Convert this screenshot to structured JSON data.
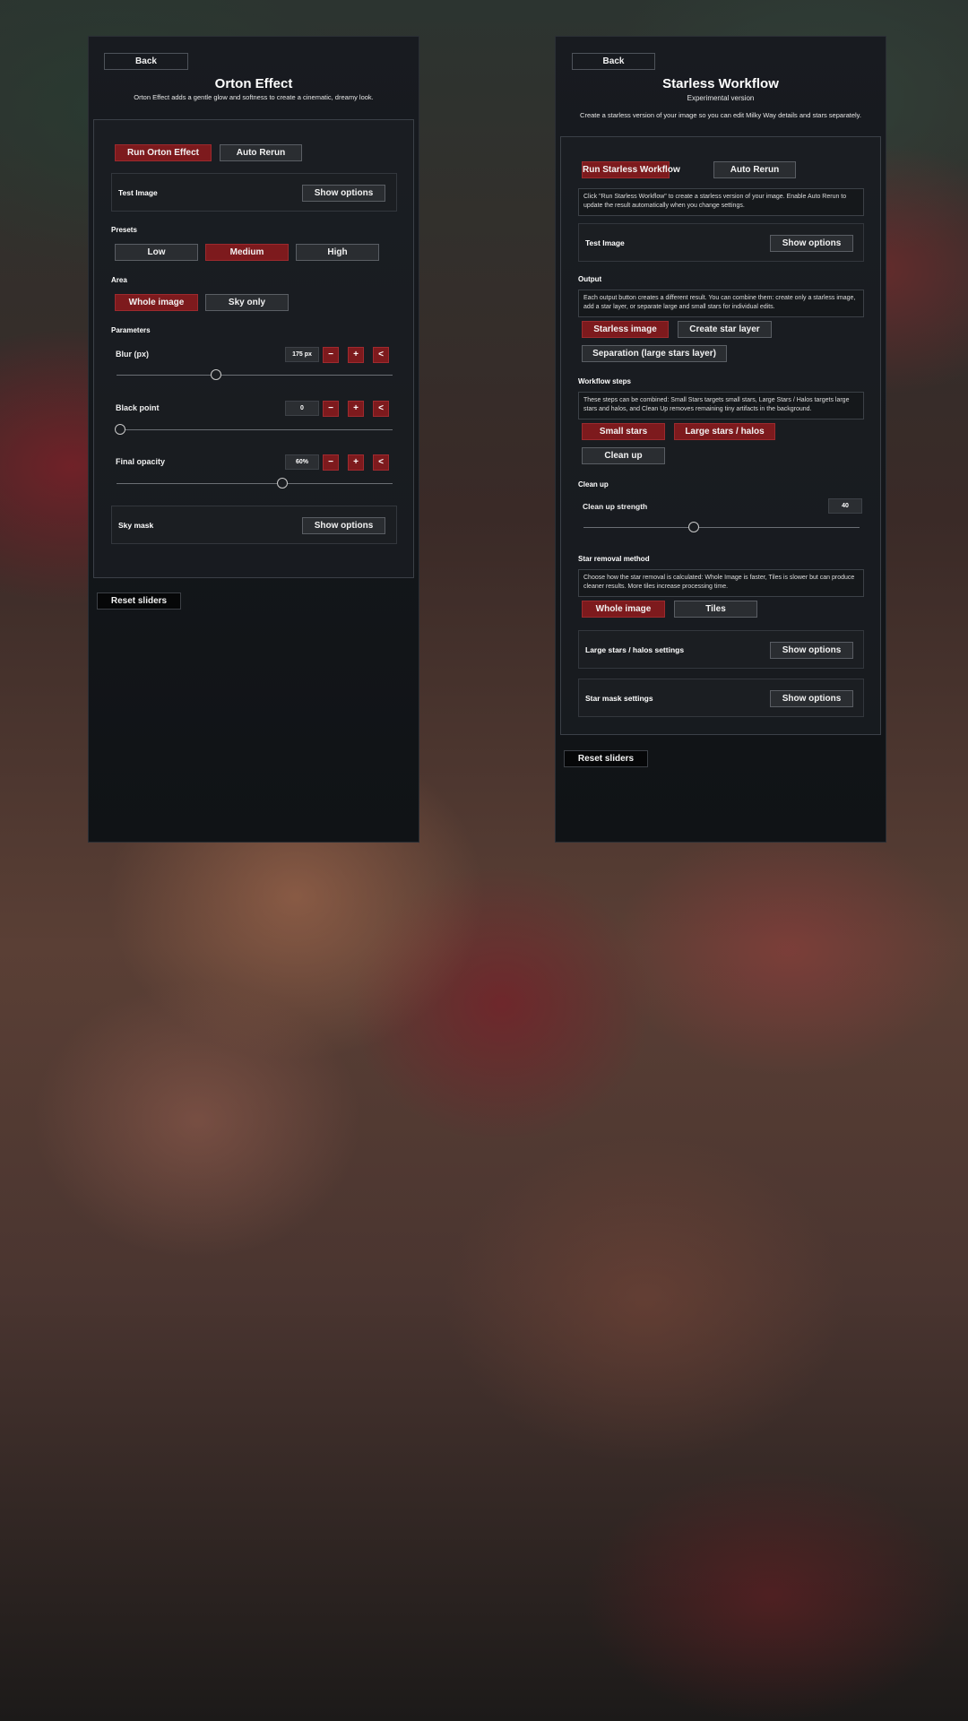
{
  "left": {
    "back_label": "Back",
    "title": "Orton Effect",
    "description": "Orton Effect adds a gentle glow and softness to create a cinematic, dreamy look.",
    "run_label": "Run Orton Effect",
    "auto_rerun_label": "Auto Rerun",
    "test_image_label": "Test Image",
    "show_options_label": "Show options",
    "presets_label": "Presets",
    "presets": [
      "Low",
      "Medium",
      "High"
    ],
    "presets_selected": "Medium",
    "area_label": "Area",
    "area_options": [
      "Whole image",
      "Sky only"
    ],
    "area_selected": "Whole image",
    "parameters_label": "Parameters",
    "params": [
      {
        "label": "Blur (px)",
        "value": "175 px",
        "fraction": 0.36
      },
      {
        "label": "Black point",
        "value": "0",
        "fraction": 0.0
      },
      {
        "label": "Final opacity",
        "value": "60%",
        "fraction": 0.6
      }
    ],
    "minus": "−",
    "plus": "+",
    "reset_arrow": "<",
    "sky_mask_label": "Sky mask",
    "sky_show_options_label": "Show options",
    "reset_sliders_label": "Reset sliders"
  },
  "right": {
    "back_label": "Back",
    "title": "Starless Workflow",
    "subtitle": "Experimental version",
    "description": "Create a starless version of your image so you can edit Milky Way details and stars separately.",
    "run_label": "Run Starless Workflow",
    "auto_rerun_label": "Auto Rerun",
    "run_info": "Click \"Run Starless Workflow\" to create a starless version of your image. Enable Auto Rerun to update the result automatically when you change settings.",
    "test_image_label": "Test Image",
    "show_options_label": "Show options",
    "output_label": "Output",
    "output_info": "Each output button creates a different result. You can combine them: create only a starless image, add a star layer, or separate large and small stars for individual edits.",
    "output_buttons": [
      "Starless image",
      "Create star layer",
      "Separation (large stars layer)"
    ],
    "workflow_label": "Workflow steps",
    "workflow_info": "These steps can be combined: Small Stars targets small stars, Large Stars / Halos targets large stars and halos, and Clean Up removes remaining tiny artifacts in the background.",
    "workflow_buttons": [
      "Small stars",
      "Large stars / halos",
      "Clean up"
    ],
    "cleanup_label": "Clean up",
    "cleanup_strength_label": "Clean up strength",
    "cleanup_value": "40",
    "cleanup_fraction": 0.4,
    "method_label": "Star removal method",
    "method_info": "Choose how the star removal is calculated: Whole Image is faster, Tiles is slower but can produce cleaner results. More tiles increase processing time.",
    "method_buttons": [
      "Whole image",
      "Tiles"
    ],
    "large_stars_settings_label": "Large stars / halos settings",
    "star_mask_settings_label": "Star mask settings",
    "reset_sliders_label": "Reset sliders"
  },
  "colors": {
    "accent_red": "#7d1a1d",
    "panel_bg": "#14171b"
  }
}
